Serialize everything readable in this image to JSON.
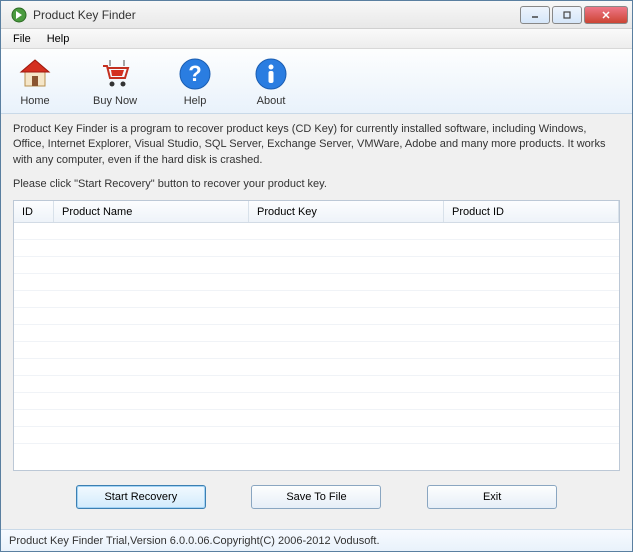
{
  "window": {
    "title": "Product Key Finder"
  },
  "menubar": {
    "file": "File",
    "help": "Help"
  },
  "toolbar": {
    "home": "Home",
    "buynow": "Buy Now",
    "help": "Help",
    "about": "About"
  },
  "description": {
    "line1": "Product Key Finder is a program to recover product keys (CD Key) for currently installed software, including Windows, Office, Internet Explorer, Visual Studio, SQL Server, Exchange Server, VMWare, Adobe and many more products. It works with any computer, even if the hard disk is crashed.",
    "line2": "Please click \"Start Recovery\" button to recover your product key."
  },
  "table": {
    "headers": {
      "id": "ID",
      "name": "Product Name",
      "key": "Product Key",
      "pid": "Product ID"
    },
    "rows": []
  },
  "buttons": {
    "start": "Start Recovery",
    "save": "Save To File",
    "exit": "Exit"
  },
  "statusbar": {
    "text": "Product Key Finder Trial,Version 6.0.0.06.Copyright(C) 2006-2012 Vodusoft."
  }
}
